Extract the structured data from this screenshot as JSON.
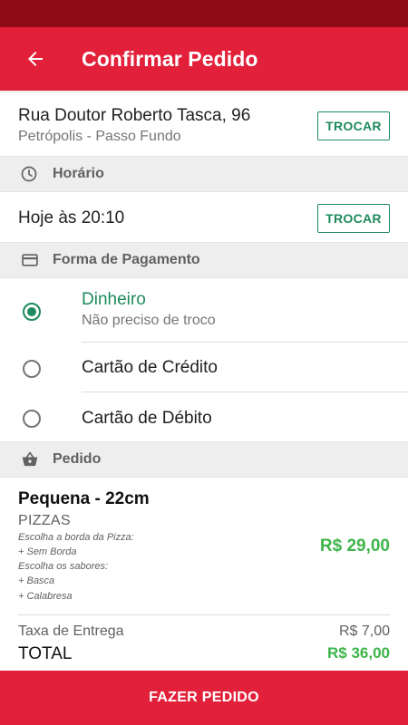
{
  "app_bar": {
    "title": "Confirmar Pedido",
    "back_icon": "arrow-left-icon",
    "color": "#e2203a",
    "status_bar_color": "#8e0a14"
  },
  "address": {
    "street": "Rua Doutor Roberto Tasca, 96",
    "district": "Petrópolis - Passo Fundo",
    "change_label": "TROCAR"
  },
  "schedule": {
    "section_label": "Horário",
    "icon": "clock-icon",
    "time": "Hoje às 20:10",
    "change_label": "TROCAR"
  },
  "payment": {
    "section_label": "Forma de Pagamento",
    "icon": "credit-card-icon",
    "options": [
      {
        "label": "Dinheiro",
        "sublabel": "Não preciso de troco",
        "selected": true
      },
      {
        "label": "Cartão de Crédito",
        "selected": false
      },
      {
        "label": "Cartão de Débito",
        "selected": false
      }
    ]
  },
  "order": {
    "section_label": "Pedido",
    "icon": "basket-icon",
    "item": {
      "name": "Pequena - 22cm",
      "category": "PIZZAS",
      "options": [
        "Escolha a borda da Pizza:",
        "+ Sem Borda",
        "Escolha os sabores:",
        "+ Basca",
        "+ Calabresa"
      ],
      "price": "R$ 29,00"
    },
    "delivery_fee_label": "Taxa de Entrega",
    "delivery_fee": "R$ 7,00",
    "total_label": "TOTAL",
    "total": "R$ 36,00"
  },
  "cta": {
    "label": "FAZER PEDIDO"
  },
  "colors": {
    "accent_green": "#1e8a5c",
    "price_green": "#3db54a"
  }
}
